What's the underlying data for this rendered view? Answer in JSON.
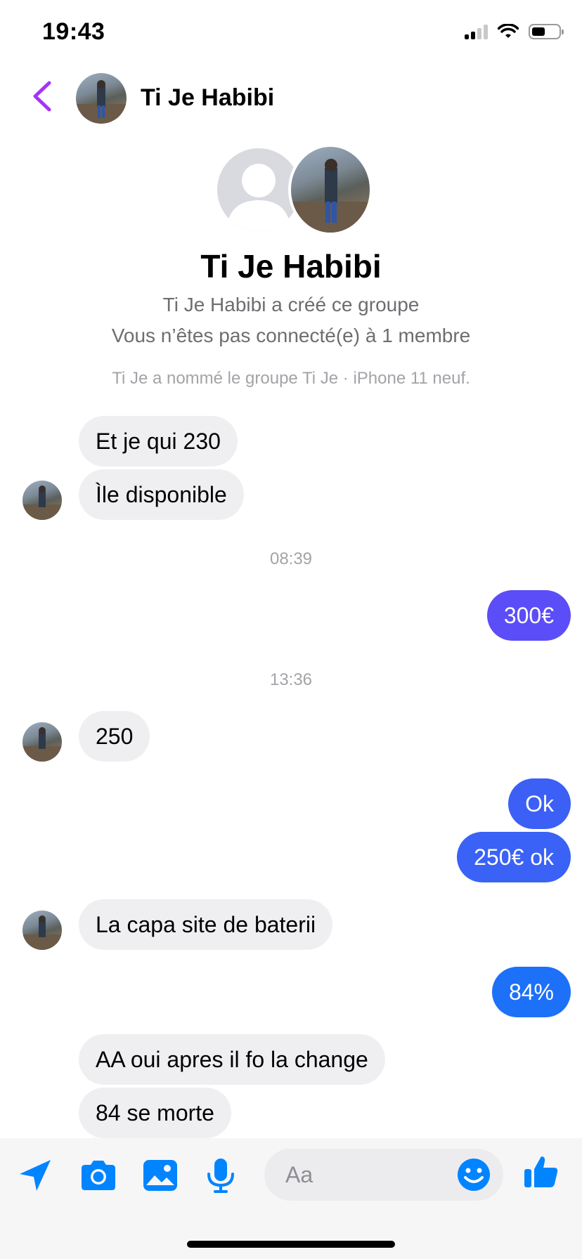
{
  "status_bar": {
    "time": "19:43"
  },
  "header": {
    "title": "Ti Je Habibi"
  },
  "group_info": {
    "name": "Ti Je Habibi",
    "created": "Ti Je Habibi a créé ce groupe",
    "not_connected": "Vous n’êtes pas connecté(e) à 1 membre",
    "rename_notice": "Ti Je a nommé le groupe Ti Je · iPhone 11 neuf."
  },
  "timestamps": [
    "08:39",
    "13:36"
  ],
  "messages": [
    {
      "direction": "in",
      "text": "Et je qui 230"
    },
    {
      "direction": "in",
      "text": "Ìle disponible"
    },
    {
      "direction": "out",
      "text": "300€"
    },
    {
      "direction": "in",
      "text": "250"
    },
    {
      "direction": "out",
      "text": "Ok"
    },
    {
      "direction": "out",
      "text": "250€ ok"
    },
    {
      "direction": "in",
      "text": "La capa site de baterii"
    },
    {
      "direction": "out",
      "text": "84%"
    },
    {
      "direction": "in",
      "text": "AA oui apres il fo la change"
    },
    {
      "direction": "in",
      "text": "84 se morte"
    }
  ],
  "composer": {
    "placeholder": "Aa",
    "value": "",
    "icons": [
      "send-location-icon",
      "camera-icon",
      "gallery-icon",
      "microphone-icon",
      "emoji-icon",
      "thumbs-up-icon"
    ]
  },
  "colors": {
    "accent": "#0084ff",
    "back_arrow": "#a334fa",
    "outgoing_bubble_top": "#5b4df7",
    "outgoing_bubble_mid": "#3d5af5",
    "outgoing_bubble_bottom": "#1a73f8",
    "incoming_bubble": "#efeff1"
  }
}
